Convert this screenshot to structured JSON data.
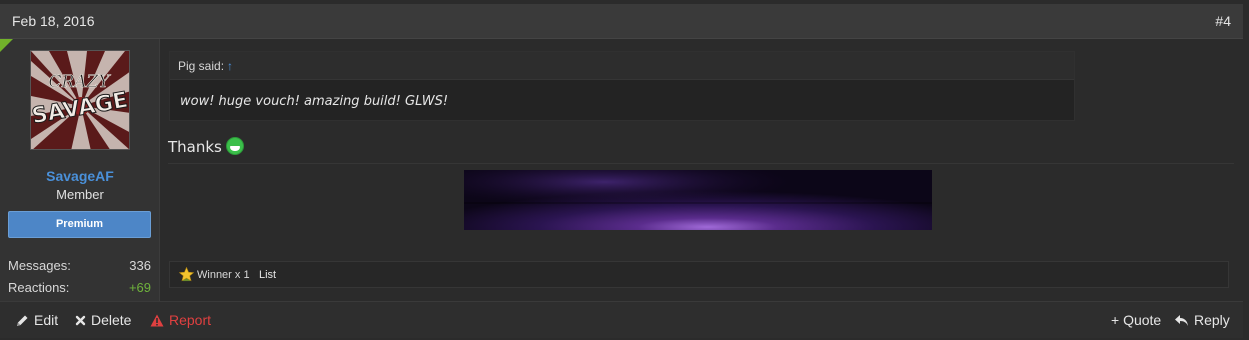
{
  "post": {
    "date": "Feb 18, 2016",
    "number": "#4"
  },
  "user": {
    "username": "SavageAF",
    "title": "Member",
    "badge": "Premium",
    "avatar_text_top": "CRAZY",
    "avatar_text_main": "SAVAGE",
    "stats": [
      {
        "label": "Messages:",
        "value": "336"
      },
      {
        "label": "Reactions:",
        "value": "+69"
      }
    ]
  },
  "quote": {
    "author": "Pig said:",
    "arrow": "↑",
    "text": "wow! huge vouch! amazing build! GLWS!"
  },
  "message": {
    "text": "Thanks",
    "emoji": "grin-emoji"
  },
  "reactions": {
    "summary": "Winner x 1",
    "list_label": "List",
    "icon": "winner-star-icon"
  },
  "actions": {
    "edit": "Edit",
    "delete": "Delete",
    "report": "Report",
    "quote": "+ Quote",
    "reply": "Reply"
  },
  "colors": {
    "username": "#4a90d9",
    "premium_badge": "#4d86c7",
    "positive": "#6fb33c",
    "report": "#e04040",
    "new_post_flag": "#72b22a"
  }
}
